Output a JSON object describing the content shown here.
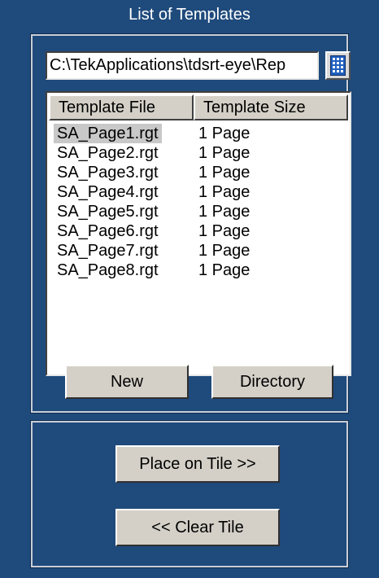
{
  "panel": {
    "title": "List of Templates"
  },
  "path": {
    "value": "C:\\TekApplications\\tdsrt-eye\\Rep"
  },
  "browse": {
    "icon": "grid-icon"
  },
  "table": {
    "columns": [
      "Template File",
      "Template Size"
    ],
    "rows": [
      {
        "file": "SA_Page1.rgt",
        "size": "1 Page",
        "selected": true
      },
      {
        "file": "SA_Page2.rgt",
        "size": "1 Page"
      },
      {
        "file": "SA_Page3.rgt",
        "size": "1 Page"
      },
      {
        "file": "SA_Page4.rgt",
        "size": "1 Page"
      },
      {
        "file": "SA_Page5.rgt",
        "size": "1 Page"
      },
      {
        "file": "SA_Page6.rgt",
        "size": "1 Page"
      },
      {
        "file": "SA_Page7.rgt",
        "size": "1 Page"
      },
      {
        "file": "SA_Page8.rgt",
        "size": "1 Page"
      }
    ]
  },
  "buttons": {
    "new": "New",
    "directory": "Directory",
    "place_on_tile": "Place on Tile >>",
    "clear_tile": "<< Clear Tile"
  },
  "colors": {
    "panel_bg": "#1f4a7c",
    "button_face": "#d4d0c8",
    "selection": "#c8c8c8"
  }
}
